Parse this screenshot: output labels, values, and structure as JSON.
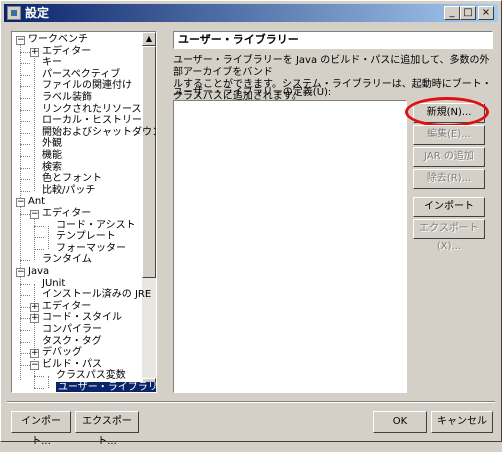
{
  "window": {
    "title": "設定",
    "controls": [
      "_",
      "□",
      "×"
    ]
  },
  "tree": {
    "items": [
      {
        "label": "ワークベンチ",
        "expander": "−"
      },
      {
        "label": "エディター",
        "expander": "+"
      },
      {
        "label": "キー"
      },
      {
        "label": "パースペクティブ"
      },
      {
        "label": "ファイルの関連付け"
      },
      {
        "label": "ラベル装飾"
      },
      {
        "label": "リンクされたリソース"
      },
      {
        "label": "ローカル・ヒストリー"
      },
      {
        "label": "開始およびシャットダウン"
      },
      {
        "label": "外観"
      },
      {
        "label": "機能"
      },
      {
        "label": "検索"
      },
      {
        "label": "色とフォント"
      },
      {
        "label": "比較/パッチ"
      },
      {
        "label": "Ant",
        "expander": "−"
      },
      {
        "label": "エディター",
        "expander": "−"
      },
      {
        "label": "コード・アシスト"
      },
      {
        "label": "テンプレート"
      },
      {
        "label": "フォーマッター"
      },
      {
        "label": "ランタイム"
      },
      {
        "label": "Java",
        "expander": "−"
      },
      {
        "label": "JUnit"
      },
      {
        "label": "インストール済みの JRE"
      },
      {
        "label": "エディター",
        "expander": "+"
      },
      {
        "label": "コード・スタイル",
        "expander": "+"
      },
      {
        "label": "コンパイラー"
      },
      {
        "label": "タスク・タグ"
      },
      {
        "label": "デバッグ",
        "expander": "+"
      },
      {
        "label": "ビルド・パス",
        "expander": "−"
      },
      {
        "label": "クラスパス変数"
      },
      {
        "label": "ユーザー・ライブラリー",
        "selected": true
      }
    ]
  },
  "panel": {
    "title": "ユーザー・ライブラリー",
    "description_line1": "ユーザー・ライブラリーを Java のビルド・パスに追加して、多数の外部アーカイブをバンド",
    "description_line2": "ルすることができます。システム・ライブラリーは、起動時にブート・クラスパスに追加されます。",
    "definition_label": "ユーザー・ライブラリーの定義(U):",
    "buttons": {
      "new": "新規(N)...",
      "edit": "編集(E)...",
      "add_jar": "JAR の追加(J)...",
      "remove": "除去(R)...",
      "import": "インポート(M)...",
      "export": "エクスポート(X)..."
    }
  },
  "footer": {
    "import": "インポート...",
    "export": "エクスポート...",
    "ok": "OK",
    "cancel": "キャンセル"
  },
  "colors": {
    "highlight_ring": "#e01010",
    "selection": "#0a246a"
  }
}
